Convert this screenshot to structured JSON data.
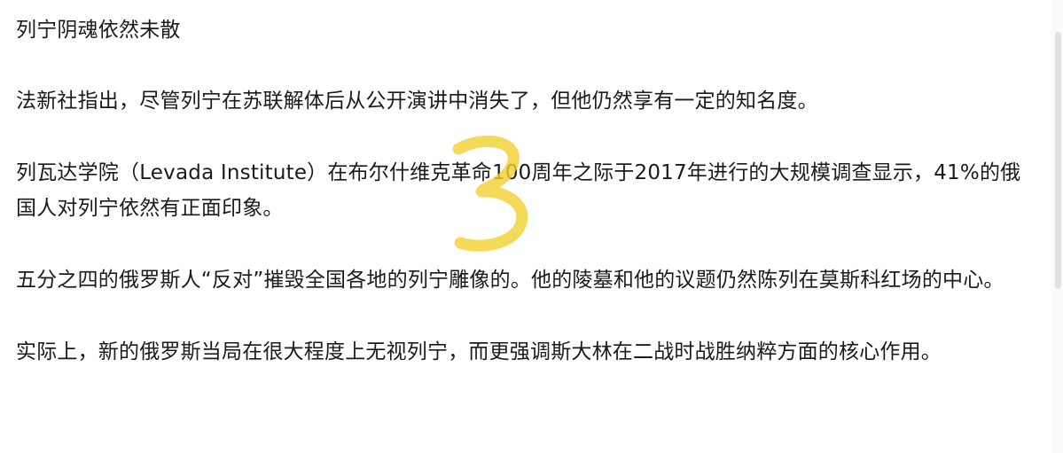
{
  "article": {
    "title": "列宁阴魂依然未散",
    "paragraphs": [
      "法新社指出，尽管列宁在苏联解体后从公开演讲中消失了，但他仍然享有一定的知名度。",
      "列瓦达学院（Levada Institute）在布尔什维克革命100周年之际于2017年进行的大规模调查显示，41%的俄国人对列宁依然有正面印象。",
      "五分之四的俄罗斯人“反对”摧毁全国各地的列宁雕像的。他的陵墓和他的议题仍然陈列在莫斯科红场的中心。",
      "实际上，新的俄罗斯当局在很大程度上无视列宁，而更强调斯大林在二战时战胜纳粹方面的核心作用。"
    ]
  },
  "annotation": {
    "mark": "3",
    "color": "#f2cf2e"
  }
}
